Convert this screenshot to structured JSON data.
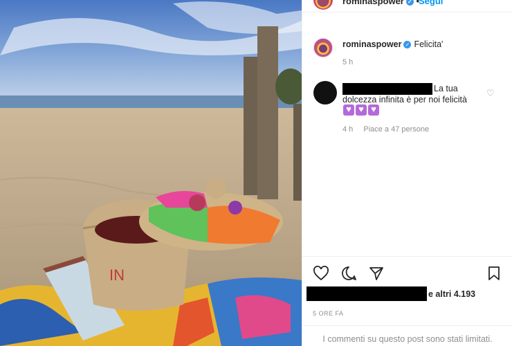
{
  "post": {
    "username": "rominaspower",
    "follow_label": "Segui",
    "more_label": "•••",
    "caption": "Felicita'",
    "caption_time": "5 h"
  },
  "comment": {
    "text": "La tua dolcezza infinita è per noi felicità",
    "time": "4 h",
    "likes_label": "Piace a 47 persone",
    "emoji": [
      "purple-heart",
      "purple-heart",
      "purple-heart"
    ]
  },
  "likes": {
    "others_label": "e altri 4.193"
  },
  "timestamp": "5 ORE FA",
  "comments_limited": "I commenti su questo post sono stati limitati.",
  "colors": {
    "link_blue": "#0095f6",
    "verified": "#3897f0",
    "muted": "#8e8e8e",
    "heart_emoji": "#b46ad8"
  },
  "icons": [
    "heart-icon",
    "comment-icon",
    "share-icon",
    "bookmark-icon",
    "verified-icon",
    "more-icon"
  ]
}
